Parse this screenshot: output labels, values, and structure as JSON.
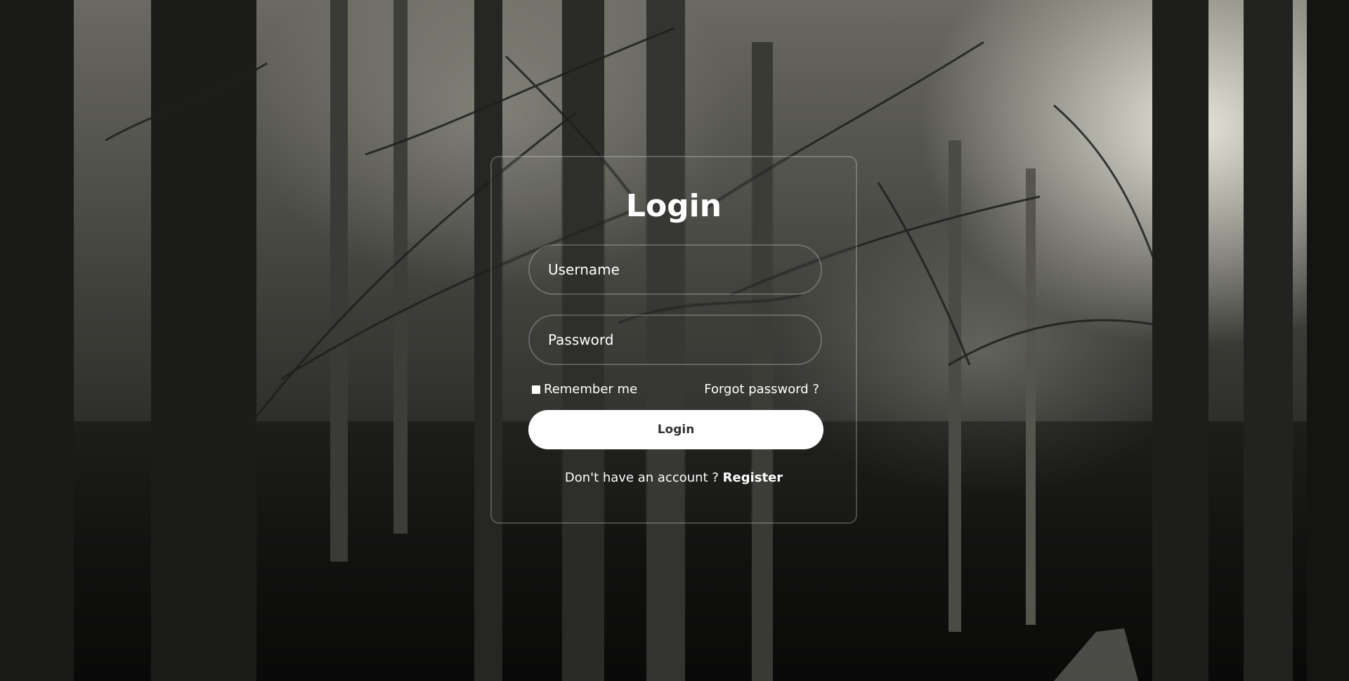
{
  "login": {
    "title": "Login",
    "username_placeholder": "Username",
    "password_placeholder": "Password",
    "remember_label": "Remember me",
    "forgot_label": "Forgot password ?",
    "submit_label": "Login",
    "register_prompt": "Don't have an account ?",
    "register_label": "Register"
  },
  "colors": {
    "text": "#ffffff",
    "button_bg": "#ffffff",
    "button_text": "#333333"
  }
}
